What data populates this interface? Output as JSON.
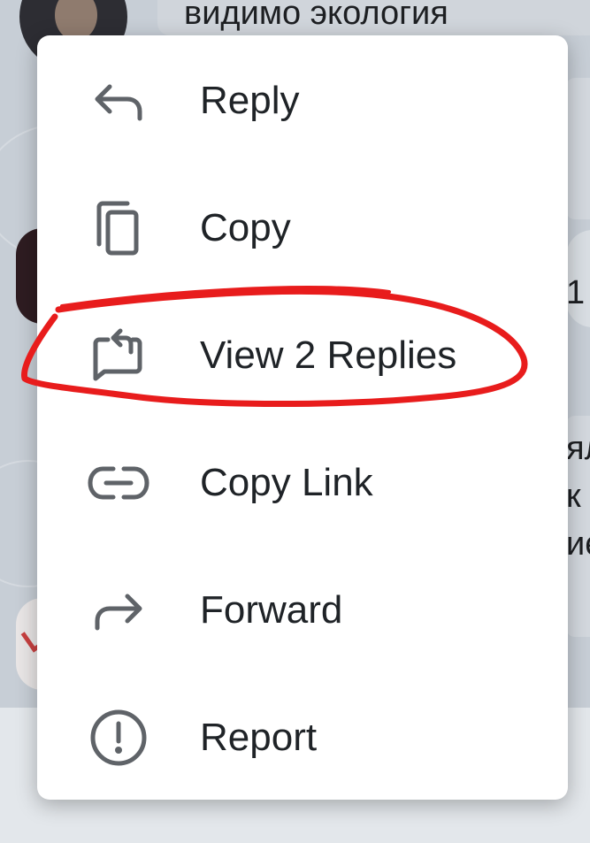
{
  "background_chat": {
    "top_message_text": "видимо экология",
    "right_edge_fragments": [
      "1",
      "ял",
      "к г",
      "иє"
    ]
  },
  "context_menu": {
    "items": [
      {
        "label": "Reply",
        "icon": "reply-icon"
      },
      {
        "label": "Copy",
        "icon": "copy-icon"
      },
      {
        "label": "View 2 Replies",
        "icon": "view-replies-icon"
      },
      {
        "label": "Copy Link",
        "icon": "link-icon"
      },
      {
        "label": "Forward",
        "icon": "forward-icon"
      },
      {
        "label": "Report",
        "icon": "report-icon"
      }
    ]
  },
  "annotation": {
    "type": "hand-drawn loop",
    "highlighted_item": "View 2 Replies",
    "color": "#e81c1c"
  },
  "colors": {
    "menu_background": "#ffffff",
    "icon_color": "#5f6368",
    "text_color": "#1f2327"
  }
}
